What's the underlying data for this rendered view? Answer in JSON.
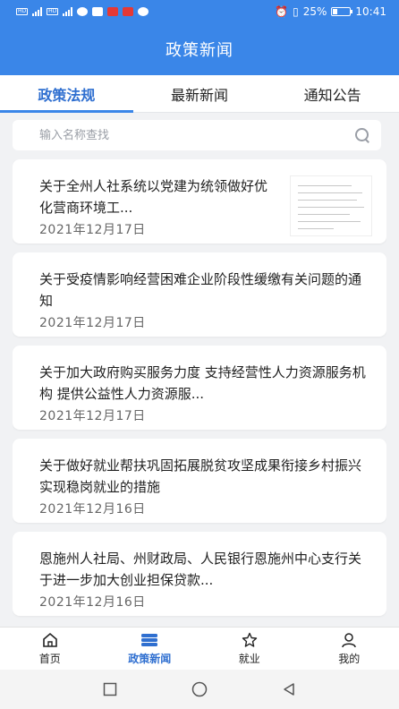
{
  "status_bar": {
    "battery": "25%",
    "time": "10:41",
    "sim_label": "HD"
  },
  "header": {
    "title": "政策新闻"
  },
  "tabs": [
    {
      "label": "政策法规",
      "active": true
    },
    {
      "label": "最新新闻",
      "active": false
    },
    {
      "label": "通知公告",
      "active": false
    }
  ],
  "search": {
    "placeholder": "输入名称查找"
  },
  "articles": [
    {
      "title": "关于全州人社系统以党建为统领做好优化营商环境工...",
      "date": "2021年12月17日",
      "has_thumbnail": true
    },
    {
      "title": "关于受疫情影响经营困难企业阶段性缓缴有关问题的通知",
      "date": "2021年12月17日",
      "has_thumbnail": false
    },
    {
      "title": "关于加大政府购买服务力度 支持经营性人力资源服务机构 提供公益性人力资源服...",
      "date": "2021年12月17日",
      "has_thumbnail": false
    },
    {
      "title": "关于做好就业帮扶巩固拓展脱贫攻坚成果衔接乡村振兴实现稳岗就业的措施",
      "date": "2021年12月16日",
      "has_thumbnail": false
    },
    {
      "title": "恩施州人社局、州财政局、人民银行恩施州中心支行关于进一步加大创业担保贷款...",
      "date": "2021年12月16日",
      "has_thumbnail": false
    }
  ],
  "bottom_nav": [
    {
      "label": "首页",
      "icon": "home-icon",
      "active": false
    },
    {
      "label": "政策新闻",
      "icon": "news-icon",
      "active": true
    },
    {
      "label": "就业",
      "icon": "star-icon",
      "active": false
    },
    {
      "label": "我的",
      "icon": "user-icon",
      "active": false
    }
  ],
  "colors": {
    "primary": "#3a86e8",
    "active_text": "#2f6fd0",
    "background": "#f1f2f4"
  }
}
